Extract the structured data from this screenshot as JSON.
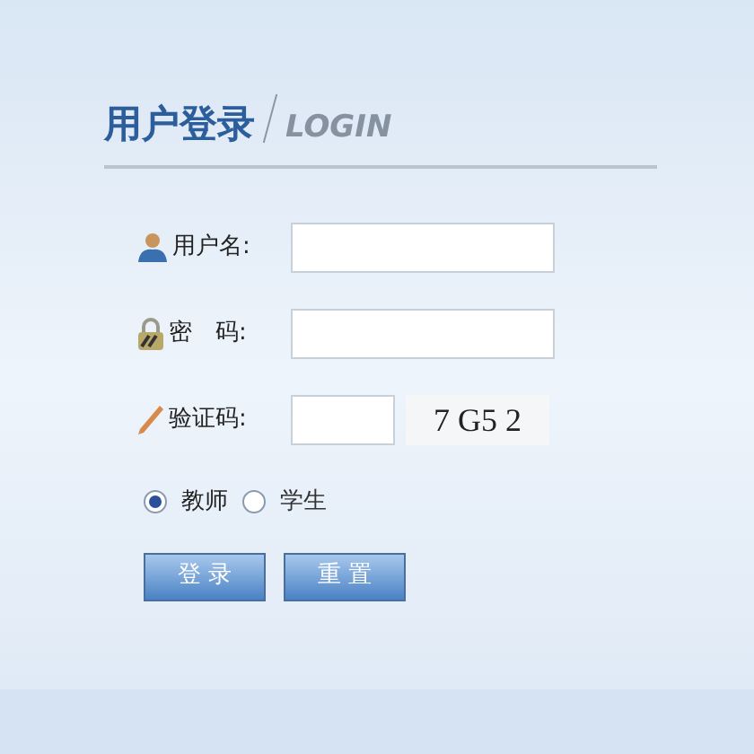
{
  "title": "用户登录",
  "subtitle": "LOGIN",
  "fields": [
    {
      "kind": "user",
      "label": "用户名:"
    },
    {
      "kind": "password",
      "label": "密　码:"
    },
    {
      "kind": "captcha",
      "label": "验证码:",
      "captcha": "7 G5 2"
    }
  ],
  "roles": [
    {
      "label": "教师",
      "selected": true
    },
    {
      "label": "学生",
      "selected": false
    }
  ],
  "buttons": [
    "登 录",
    "重 置"
  ]
}
